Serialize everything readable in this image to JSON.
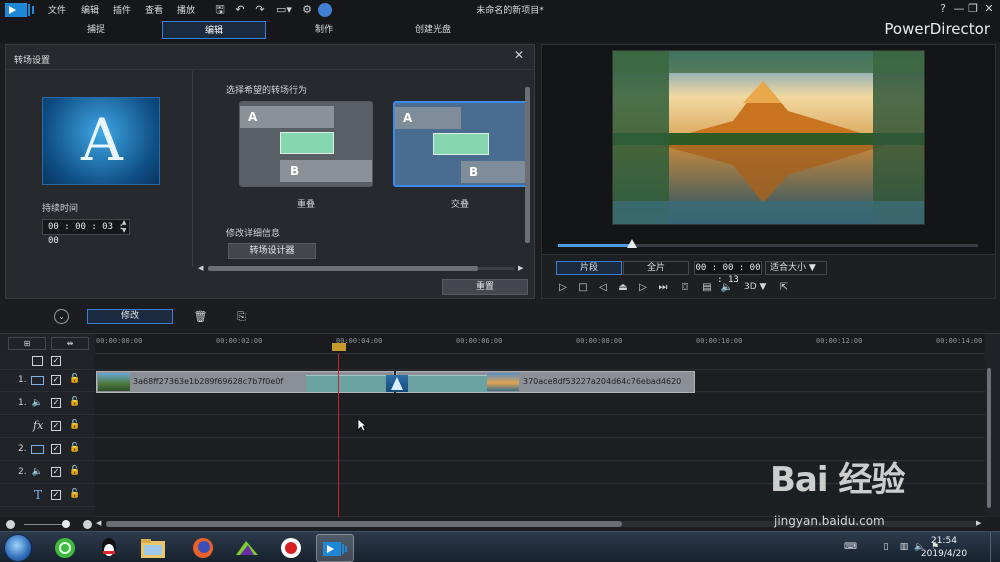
{
  "menu": {
    "items": [
      "文件",
      "编辑",
      "插件",
      "查看",
      "播放"
    ],
    "window_title": "未命名的新项目*",
    "help": "?"
  },
  "modes": {
    "tabs": [
      "捕捉",
      "编辑",
      "制作",
      "创建光盘"
    ],
    "active": "编辑",
    "brand": "PowerDirector"
  },
  "panel": {
    "title": "转场设置",
    "thumb_letter": "A",
    "duration_label": "持续时间",
    "duration_value": "00 : 00 : 03 : 00",
    "behavior_label": "选择希望的转场行为",
    "choices": [
      {
        "caption": "重叠",
        "a": "A",
        "b": "B",
        "selected": false
      },
      {
        "caption": "交叠",
        "a": "A",
        "b": "B",
        "selected": true
      }
    ],
    "detail_label": "修改详细信息",
    "designer_button": "转场设计器",
    "reset_button": "重置"
  },
  "preview": {
    "tab_clip": "片段",
    "tab_movie": "全片",
    "timecode": "00 : 00 : 00 : 13",
    "fit": "适合大小 ▼",
    "mode_3d": "3D ▼",
    "seek_fraction": 0.175
  },
  "edit_toolbar": {
    "modify_button": "修改"
  },
  "timeline": {
    "ruler": [
      "00:00:00:00",
      "00:00:02:00",
      "00:00:04:00",
      "00:00:06:00",
      "00:00:08:00",
      "00:00:10:00",
      "00:00:12:00",
      "00:00:14:00"
    ],
    "tracks": [
      {
        "num": "1.",
        "icon": "video-track-icon"
      },
      {
        "num": "1.",
        "icon": "audio-track-icon"
      },
      {
        "num": "",
        "icon": "fx-track-icon"
      },
      {
        "num": "2.",
        "icon": "video-track-icon"
      },
      {
        "num": "2.",
        "icon": "audio-track-icon"
      },
      {
        "num": "",
        "icon": "title-track-icon"
      }
    ],
    "fx_symbol": "fx",
    "title_symbol": "T",
    "clip1_name": "3a68ff27363e1b289f69628c7b7f0e0f",
    "clip2_name": "370ace8df53227a204d64c76ebad4620"
  },
  "taskbar": {
    "time": "21:54",
    "date": "2019/4/20"
  },
  "watermark": {
    "logo": "Bai 经验",
    "url": "jingyan.baidu.com"
  }
}
